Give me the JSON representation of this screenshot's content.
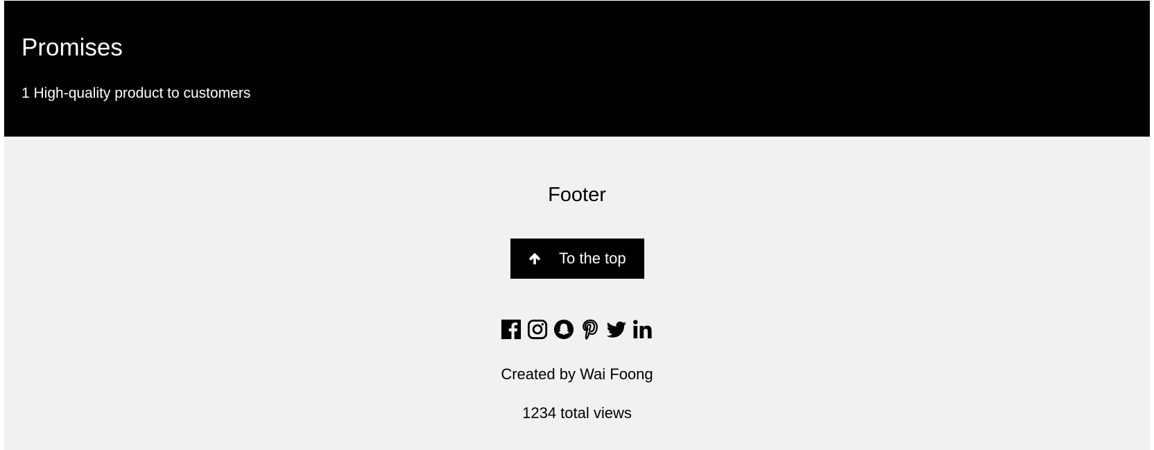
{
  "promises": {
    "title": "Promises",
    "items": [
      "1 High-quality product to customers"
    ]
  },
  "footer": {
    "title": "Footer",
    "top_button_label": "To the top",
    "top_button_icon": "arrow-up-icon",
    "social_icons": [
      "facebook-icon",
      "instagram-icon",
      "snapchat-icon",
      "pinterest-icon",
      "twitter-icon",
      "linkedin-icon"
    ],
    "created_by": "Created by Wai Foong",
    "views": "1234 total views"
  },
  "colors": {
    "promises_bg": "#000000",
    "footer_bg": "#f1f1f1",
    "button_bg": "#000000",
    "text_light": "#ffffff",
    "text_dark": "#000000"
  }
}
